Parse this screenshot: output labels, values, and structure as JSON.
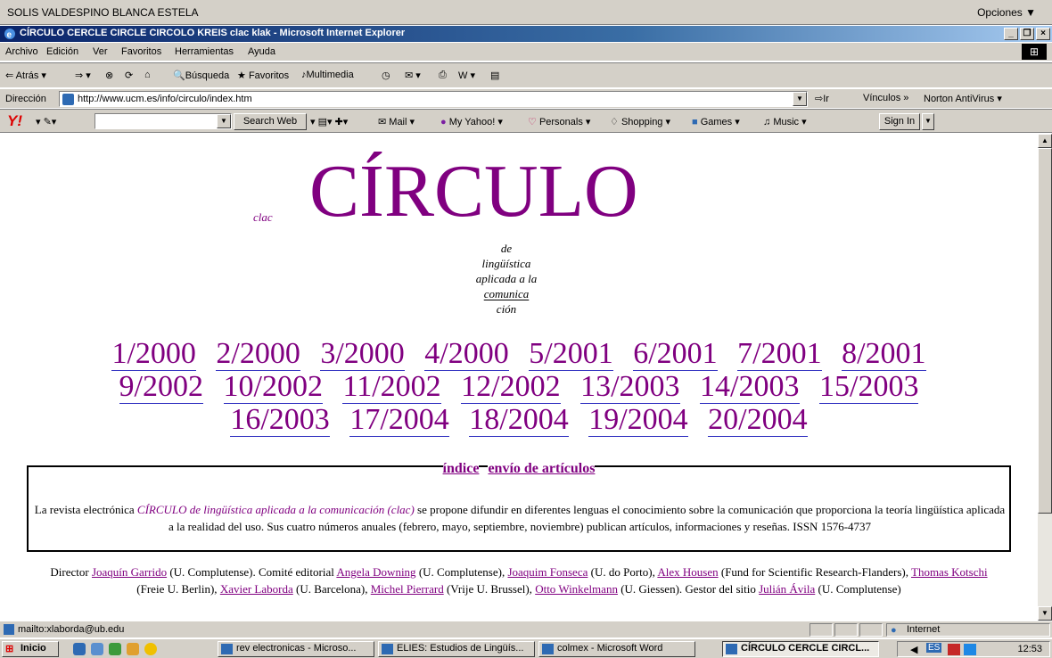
{
  "user_bar": {
    "user": "SOLIS VALDESPINO BLANCA ESTELA",
    "options": "Opciones ▼"
  },
  "window": {
    "title": "CÍRCULO CERCLE CIRCLE CIRCOLO KREIS clac klak - Microsoft Internet Explorer",
    "min": "_",
    "max": "❐",
    "close": "×"
  },
  "menu": [
    "Archivo",
    "Edición",
    "Ver",
    "Favoritos",
    "Herramientas",
    "Ayuda"
  ],
  "toolbar": {
    "back": "Atrás",
    "search": "Búsqueda",
    "favorites": "Favoritos",
    "media": "Multimedia"
  },
  "address": {
    "label": "Dirección",
    "url": "http://www.ucm.es/info/circulo/index.htm",
    "go": "Ir",
    "links": "Vínculos",
    "norton": "Norton AntiVirus"
  },
  "yahoo": {
    "logo": "Y!",
    "search_button": "Search Web",
    "mail": "Mail",
    "my_yahoo": "My Yahoo!",
    "personals": "Personals",
    "shopping": "Shopping",
    "games": "Games",
    "music": "Music",
    "sign_in": "Sign In"
  },
  "page": {
    "title": "CÍRCULO",
    "clac": "clac",
    "subtitle": [
      "de",
      "lingüística",
      "aplicada a la",
      "comunica",
      "ción"
    ],
    "issues_row1": [
      "1/2000",
      "2/2000",
      "3/2000",
      "4/2000",
      "5/2001",
      "6/2001",
      "7/2001",
      "8/2001"
    ],
    "issues_row2": [
      "9/2002",
      "10/2002",
      "11/2002",
      "12/2002",
      "13/2003",
      "14/2003",
      "15/2003"
    ],
    "issues_row3": [
      "16/2003",
      "17/2004",
      "18/2004",
      "19/2004",
      "20/2004"
    ],
    "box_link_index": "índice",
    "box_link_submit": "envío de artículos",
    "box_text_pre": "La revista electrónica ",
    "box_text_journal": "CÍRCULO de lingüística aplicada a la comunicación (clac)",
    "box_text_post": " se propone difundir en diferentes lenguas el conocimiento sobre la comunicación que proporciona la teoría lingüística aplicada a la realidad del uso. Sus cuatro números anuales (febrero, mayo, septiembre, noviembre) publican artículos, informaciones y reseñas. ISSN 1576-4737",
    "credits": {
      "director_label": "Director ",
      "director": "Joaquín Garrido",
      "director_aff": " (U. Complutense). Comité editorial ",
      "e1": "Angela Downing",
      "a1": " (U. Complutense), ",
      "e2": "Joaquim Fonseca",
      "a2": " (U. do Porto), ",
      "e3": "Alex Housen",
      "a3": " (Fund for Scientific Research-Flanders), ",
      "e4": "Thomas Kotschi",
      "a4": " (Freie U. Berlin), ",
      "e5": "Xavier Laborda",
      "a5": " (U. Barcelona), ",
      "e6": "Michel Pierrard",
      "a6": " (Vrije U. Brussel), ",
      "e7": "Otto Winkelmann",
      "a7": " (U. Giessen). Gestor del sitio ",
      "e8": "Julián Ávila",
      "a8": " (U. Complutense)"
    }
  },
  "status": {
    "text": "mailto:xlaborda@ub.edu",
    "zone": "Internet"
  },
  "taskbar": {
    "start": "Inicio",
    "tasks": [
      "rev electronicas - Microso...",
      "ELIES: Estudios de Lingüís...",
      "colmex - Microsoft Word",
      "CÍRCULO CERCLE CIRCL..."
    ],
    "lang": "ES",
    "clock": "12:53"
  },
  "colors": {
    "link": "#800080",
    "titlebar": "#0a246a"
  }
}
